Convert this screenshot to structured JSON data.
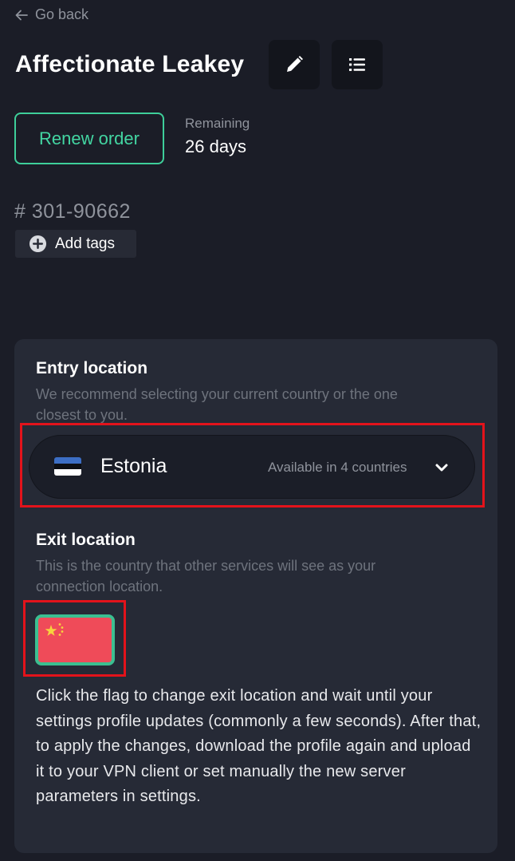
{
  "nav": {
    "back_label": "Go back"
  },
  "header": {
    "title": "Affectionate Leakey",
    "edit_icon": "pencil-icon",
    "list_icon": "list-icon"
  },
  "order": {
    "renew_label": "Renew order",
    "remaining_label": "Remaining",
    "remaining_value": "26 days",
    "order_id": "# 301-90662",
    "add_tags_label": "Add tags"
  },
  "entry": {
    "title": "Entry location",
    "description": "We recommend selecting your current country or the one closest to you.",
    "selected_country": "Estonia",
    "flag": "estonia-flag",
    "availability": "Available in 4 countries"
  },
  "exit": {
    "title": "Exit location",
    "description": "This is the country that other services will see as your connection location.",
    "flag": "china-flag",
    "instructions": "Click the flag to change exit location and wait until your settings profile updates (commonly a few seconds). After that, to apply the changes, download the profile again and upload it to your VPN client or set manually the new server parameters in settings."
  },
  "colors": {
    "background": "#1b1d27",
    "card": "#262a36",
    "accent": "#3ecf9a",
    "highlight": "#e3131b",
    "muted_text": "#8f939c"
  }
}
